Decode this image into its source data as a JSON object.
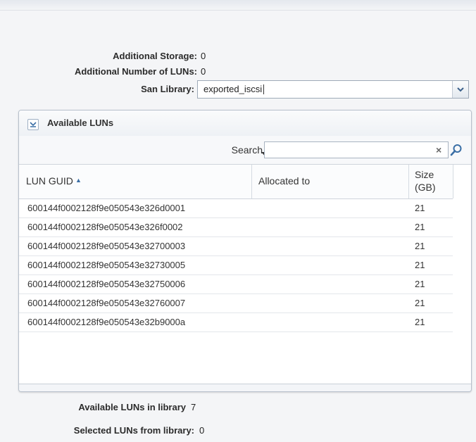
{
  "form": {
    "additional_storage_label": "Additional Storage:",
    "additional_storage_value": "0",
    "additional_luns_label": "Additional Number of LUNs:",
    "additional_luns_value": "0",
    "san_library_label": "San Library:",
    "san_library_value": "exported_iscsi"
  },
  "panel": {
    "title": "Available LUNs",
    "search_label": "Search",
    "search_placeholder": "",
    "columns": [
      "LUN GUID",
      "Allocated to",
      "Size (GB)"
    ],
    "size_col_line1": "Size",
    "size_col_line2": "(GB)",
    "sort_indicator": "▲",
    "rows": [
      {
        "guid": "600144f0002128f9e050543e326d0001",
        "allocated_to": "",
        "size": "21"
      },
      {
        "guid": "600144f0002128f9e050543e326f0002",
        "allocated_to": "",
        "size": "21"
      },
      {
        "guid": "600144f0002128f9e050543e32700003",
        "allocated_to": "",
        "size": "21"
      },
      {
        "guid": "600144f0002128f9e050543e32730005",
        "allocated_to": "",
        "size": "21"
      },
      {
        "guid": "600144f0002128f9e050543e32750006",
        "allocated_to": "",
        "size": "21"
      },
      {
        "guid": "600144f0002128f9e050543e32760007",
        "allocated_to": "",
        "size": "21"
      },
      {
        "guid": "600144f0002128f9e050543e32b9000a",
        "allocated_to": "",
        "size": "21"
      }
    ]
  },
  "summary": {
    "available_label": "Available LUNs in library",
    "available_value": "7",
    "selected_label": "Selected LUNs from library:",
    "selected_value": "0"
  },
  "icons": {
    "dropdown": "chevron-down-icon",
    "collapse": "collapse-icon",
    "clear": "close-icon",
    "search": "search-icon"
  },
  "colors": {
    "accent": "#3a6ea5",
    "panel_border": "#b7c0cc"
  }
}
